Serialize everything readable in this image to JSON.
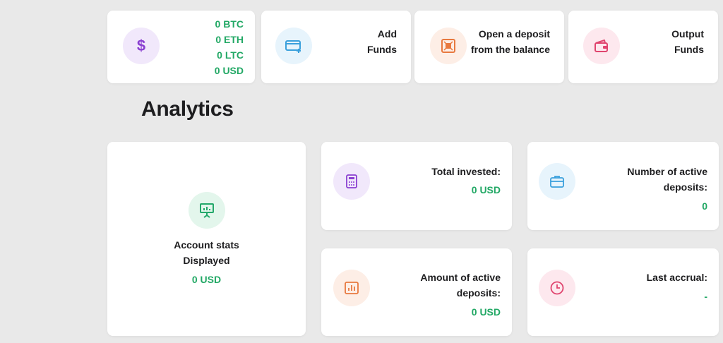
{
  "balance": {
    "btc": "0 BTC",
    "eth": "0 ETH",
    "ltc": "0 LTC",
    "usd": "0 USD",
    "icon": "dollar-icon"
  },
  "actions": {
    "add_funds": {
      "line1": "Add",
      "line2": "Funds",
      "icon": "card-add-icon"
    },
    "open_deposit": {
      "line1": "Open a deposit",
      "line2": "from the balance",
      "icon": "safe-icon"
    },
    "output_funds": {
      "line1": "Output",
      "line2": "Funds",
      "icon": "wallet-icon"
    }
  },
  "analytics": {
    "title": "Analytics",
    "account_stats": {
      "line1": "Account stats",
      "line2": "Displayed",
      "value": "0 USD",
      "icon": "presentation-chart-icon"
    },
    "total_invested": {
      "label": "Total invested:",
      "value": "0 USD",
      "icon": "calculator-icon"
    },
    "active_deposits_count": {
      "line1": "Number of active",
      "line2": "deposits:",
      "value": "0",
      "icon": "briefcase-icon"
    },
    "active_deposits_amount": {
      "line1": "Amount of active",
      "line2": "deposits:",
      "value": "0 USD",
      "icon": "bar-chart-icon"
    },
    "last_accrual": {
      "label": "Last accrual:",
      "value": "-",
      "icon": "clock-icon"
    }
  },
  "colors": {
    "accent_green": "#22a865",
    "purple_bg": "#f1e8fb",
    "purple": "#8a3fd1",
    "blue_bg": "#e7f4fc",
    "blue": "#3aa0dc",
    "orange_bg": "#fdeee6",
    "orange": "#e8793f",
    "pink_bg": "#fde8ee",
    "pink": "#e0456f",
    "green_bg": "#e3f6ec",
    "green": "#23a86a"
  }
}
